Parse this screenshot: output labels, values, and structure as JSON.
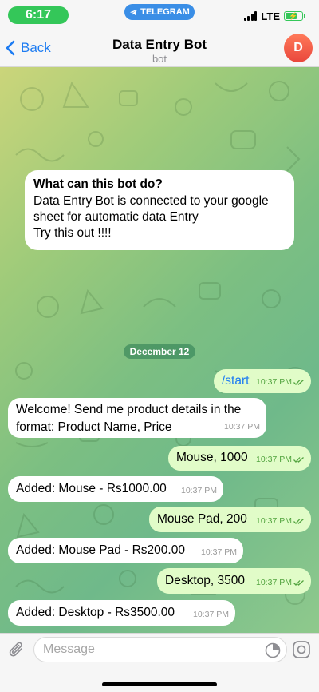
{
  "status_bar": {
    "time": "6:17",
    "app_badge": "TELEGRAM",
    "network": "LTE"
  },
  "header": {
    "back_label": "Back",
    "title": "Data Entry Bot",
    "subtitle": "bot",
    "avatar_letter": "D"
  },
  "info_card": {
    "heading": "What can this bot do?",
    "line1": "Data Entry Bot is connected to your google",
    "line2": "sheet for automatic data Entry",
    "line3": "Try this out !!!!"
  },
  "date_separator": "December 12",
  "messages": [
    {
      "direction": "out",
      "text": "/start",
      "time": "10:37 PM",
      "read": true
    },
    {
      "direction": "in",
      "text_line1": "Welcome! Send me product details in the",
      "text_line2": "format: Product Name, Price",
      "time": "10:37 PM"
    },
    {
      "direction": "out",
      "text": "Mouse, 1000",
      "time": "10:37 PM",
      "read": true
    },
    {
      "direction": "in",
      "text": "Added: Mouse - Rs1000.00",
      "time": "10:37 PM"
    },
    {
      "direction": "out",
      "text": "Mouse Pad, 200",
      "time": "10:37 PM",
      "read": true
    },
    {
      "direction": "in",
      "text": "Added: Mouse Pad - Rs200.00",
      "time": "10:37 PM"
    },
    {
      "direction": "out",
      "text": "Desktop, 3500",
      "time": "10:37 PM",
      "read": true
    },
    {
      "direction": "in",
      "text": "Added: Desktop - Rs3500.00",
      "time": "10:37 PM"
    }
  ],
  "input": {
    "placeholder": "Message"
  },
  "colors": {
    "accent": "#1d7cf2",
    "outgoing_bubble": "#e1fcc8",
    "incoming_bubble": "#ffffff",
    "read_ticks": "#52a43f",
    "avatar": "#e9473c",
    "time_pill": "#34c759"
  },
  "icons": [
    "telegram-icon",
    "back-chevron-icon",
    "attach-icon",
    "sticker-icon",
    "camera-icon",
    "double-check-icon",
    "signal-icon",
    "battery-icon"
  ]
}
